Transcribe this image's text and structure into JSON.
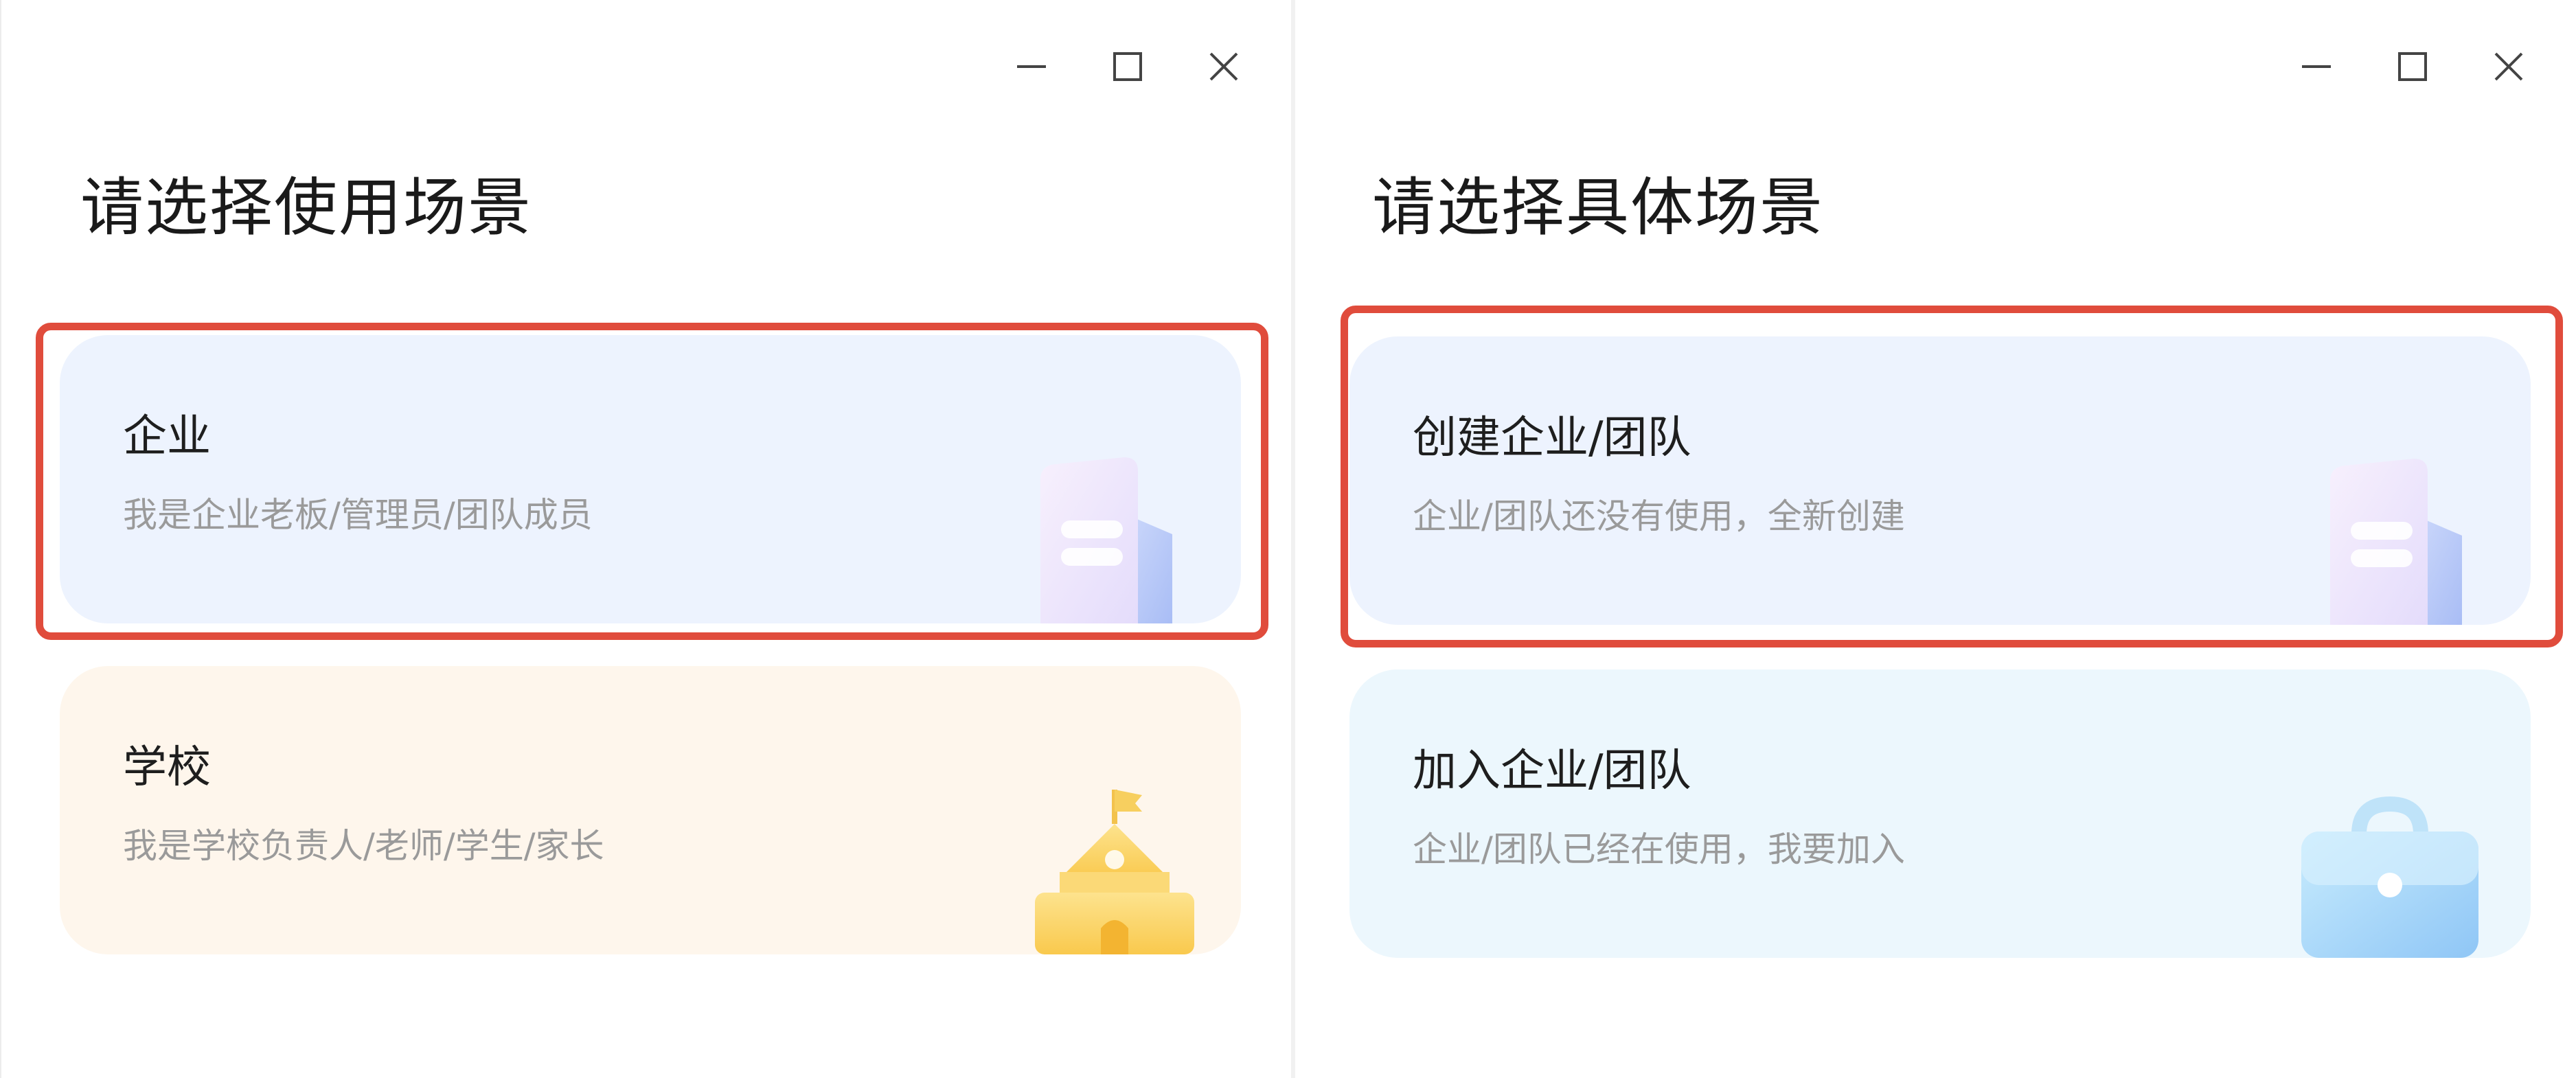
{
  "left_panel": {
    "window_controls": [
      "minimize",
      "maximize",
      "close"
    ],
    "title": "请选择使用场景",
    "cards": [
      {
        "title": "企业",
        "description": "我是企业老板/管理员/团队成员",
        "icon": "building-icon",
        "highlighted": true
      },
      {
        "title": "学校",
        "description": "我是学校负责人/老师/学生/家长",
        "icon": "school-icon",
        "highlighted": false
      }
    ]
  },
  "right_panel": {
    "window_controls": [
      "minimize",
      "maximize",
      "close"
    ],
    "title": "请选择具体场景",
    "cards": [
      {
        "title": "创建企业/团队",
        "description": "企业/团队还没有使用，全新创建",
        "icon": "building-icon",
        "highlighted": true
      },
      {
        "title": "加入企业/团队",
        "description": "企业/团队已经在使用，我要加入",
        "icon": "briefcase-icon",
        "highlighted": false
      }
    ]
  },
  "colors": {
    "highlight": "#e04c3c",
    "card_blue": "#edf3fe",
    "card_peach": "#fef6ec",
    "card_cyan": "#ecf7fd",
    "text_primary": "#1e1e1e",
    "text_secondary": "#9a9a9a"
  }
}
